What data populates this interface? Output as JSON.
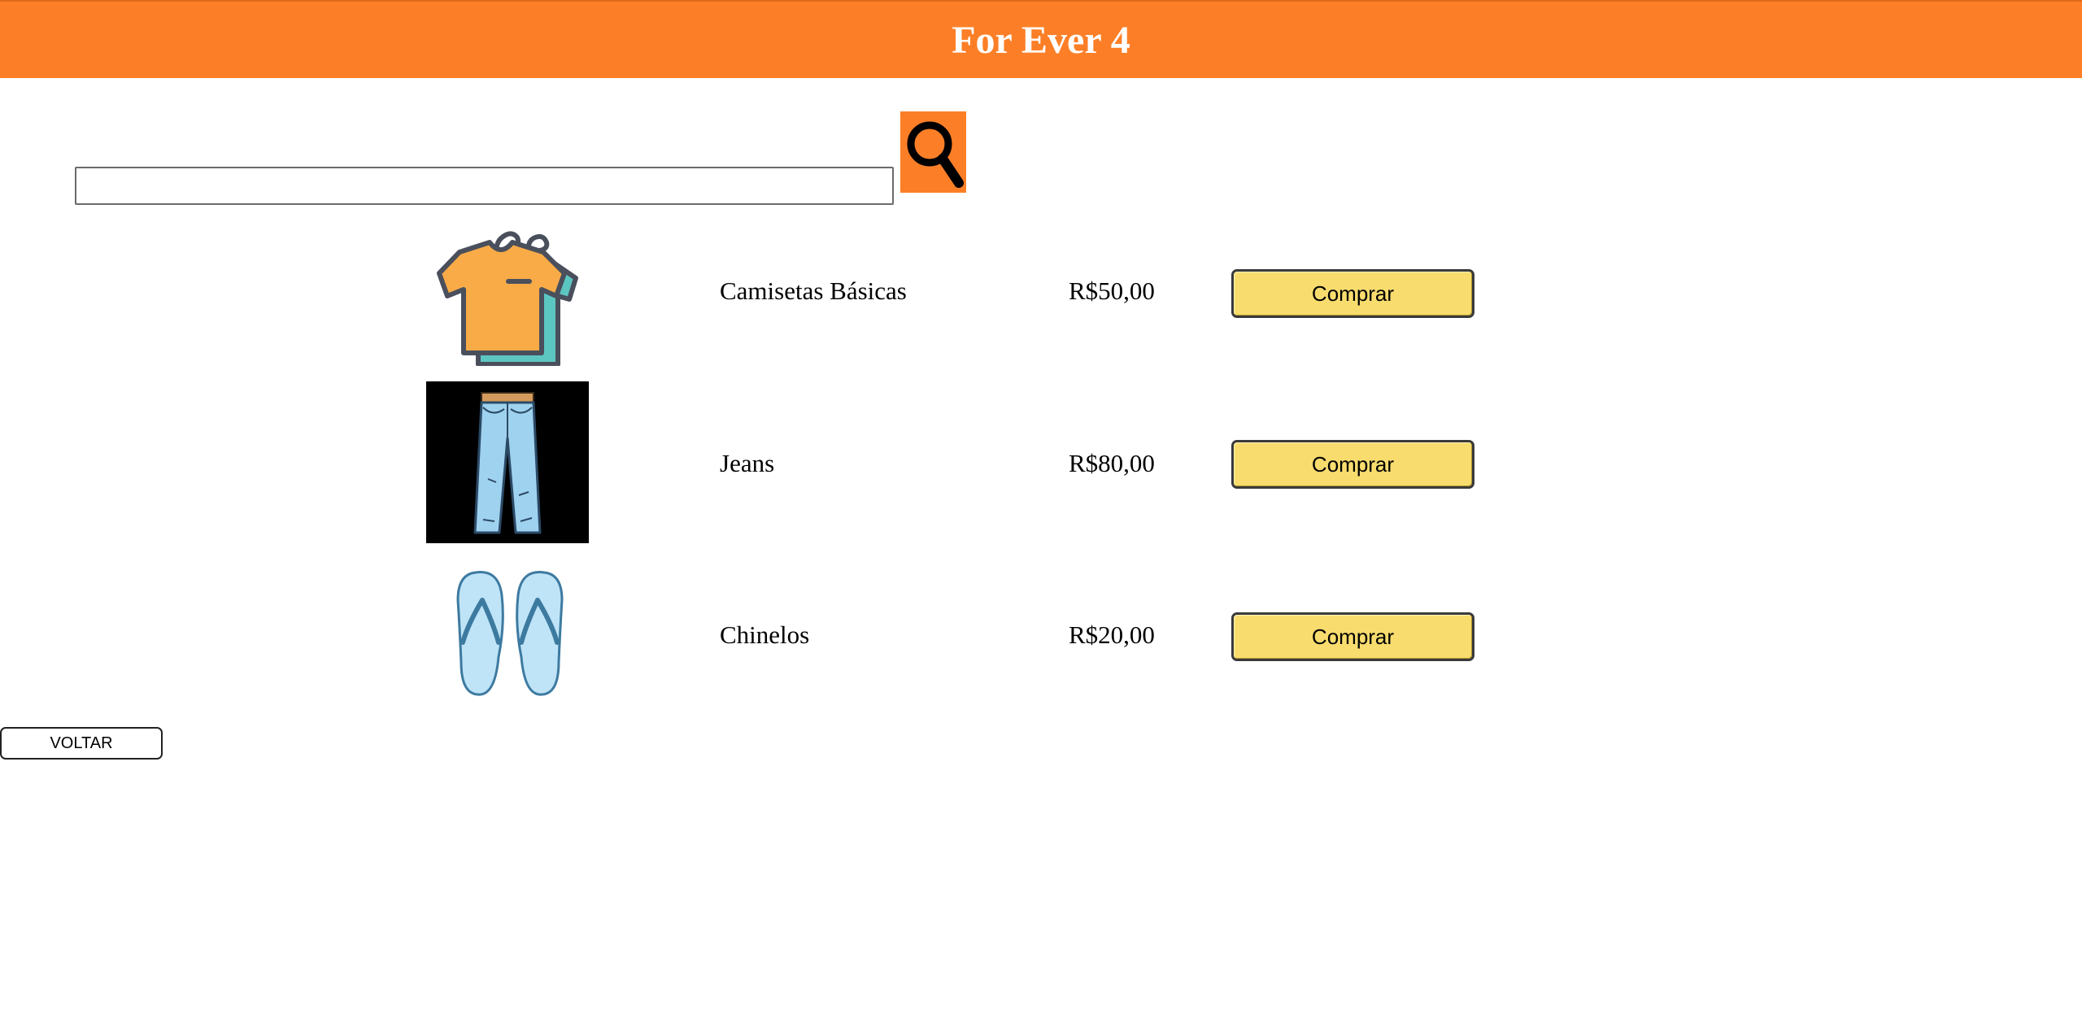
{
  "header": {
    "title": "For Ever 4"
  },
  "search": {
    "value": "",
    "placeholder": "",
    "button_icon": "search-icon"
  },
  "products": [
    {
      "name": "Camisetas Básicas",
      "price": "R$50,00",
      "buy_label": "Comprar",
      "image_icon": "tshirt-icon"
    },
    {
      "name": "Jeans",
      "price": "R$80,00",
      "buy_label": "Comprar",
      "image_icon": "jeans-icon"
    },
    {
      "name": "Chinelos",
      "price": "R$20,00",
      "buy_label": "Comprar",
      "image_icon": "flip-flops-icon"
    }
  ],
  "back": {
    "label": "VOLTAR"
  },
  "colors": {
    "accent": "#fc7f27",
    "buy_button": "#f8dc6e"
  }
}
